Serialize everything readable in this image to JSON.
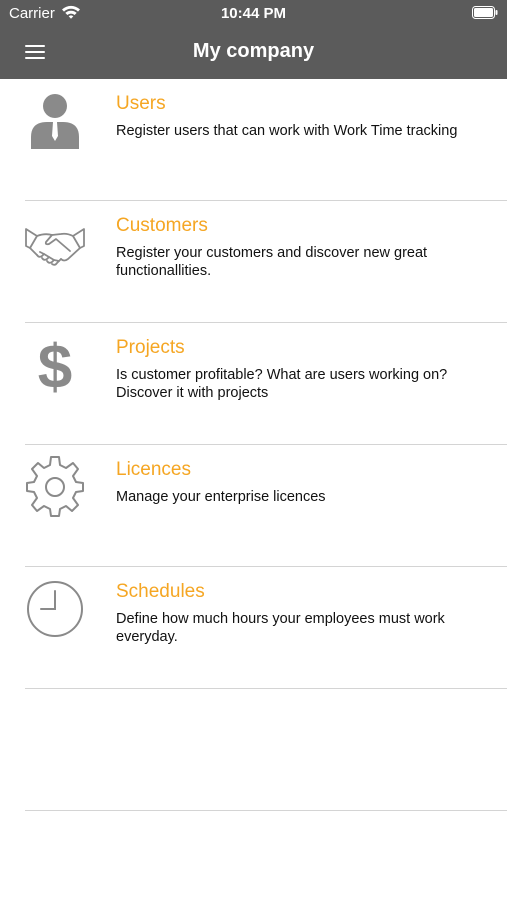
{
  "status_bar": {
    "carrier": "Carrier",
    "time": "10:44 PM"
  },
  "header": {
    "title": "My company"
  },
  "colors": {
    "header_bg": "#5b5b5b",
    "accent": "#f5a623",
    "icon": "#888888",
    "divider": "#d4d4d4"
  },
  "items": [
    {
      "icon": "user-icon",
      "title": "Users",
      "description": "Register users that can work with Work Time tracking"
    },
    {
      "icon": "handshake-icon",
      "title": "Customers",
      "description": "Register your customers and discover new great functionallities."
    },
    {
      "icon": "dollar-icon",
      "title": "Projects",
      "description": "Is customer profitable? What are users working on? Discover it with projects"
    },
    {
      "icon": "gear-icon",
      "title": "Licences",
      "description": "Manage your enterprise licences"
    },
    {
      "icon": "clock-icon",
      "title": "Schedules",
      "description": "Define how much hours your employees must work everyday."
    }
  ]
}
